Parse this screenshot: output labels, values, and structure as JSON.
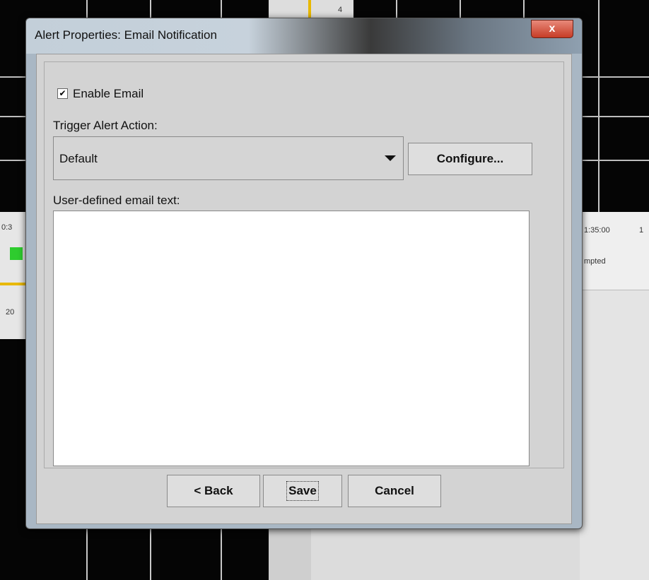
{
  "background": {
    "time_left": "0:3",
    "time_right": "1:35:00",
    "time_far": "1",
    "status_text": "mpted",
    "left_value": "20",
    "top_tab": "4"
  },
  "dialog": {
    "title": "Alert Properties: Email Notification",
    "close_label": "x",
    "enable_email": {
      "label": "Enable Email",
      "checked": true,
      "check_glyph": "✔"
    },
    "trigger_label": "Trigger Alert Action:",
    "trigger_value": "Default",
    "configure_label": "Configure...",
    "email_text_label": "User-defined email text:",
    "email_text_value": "",
    "back_label": "< Back",
    "save_label": "Save",
    "cancel_label": "Cancel"
  },
  "colors": {
    "close_button": "#c63c26",
    "accent_green": "#2ecc2e",
    "accent_yellow": "#e8b800"
  }
}
